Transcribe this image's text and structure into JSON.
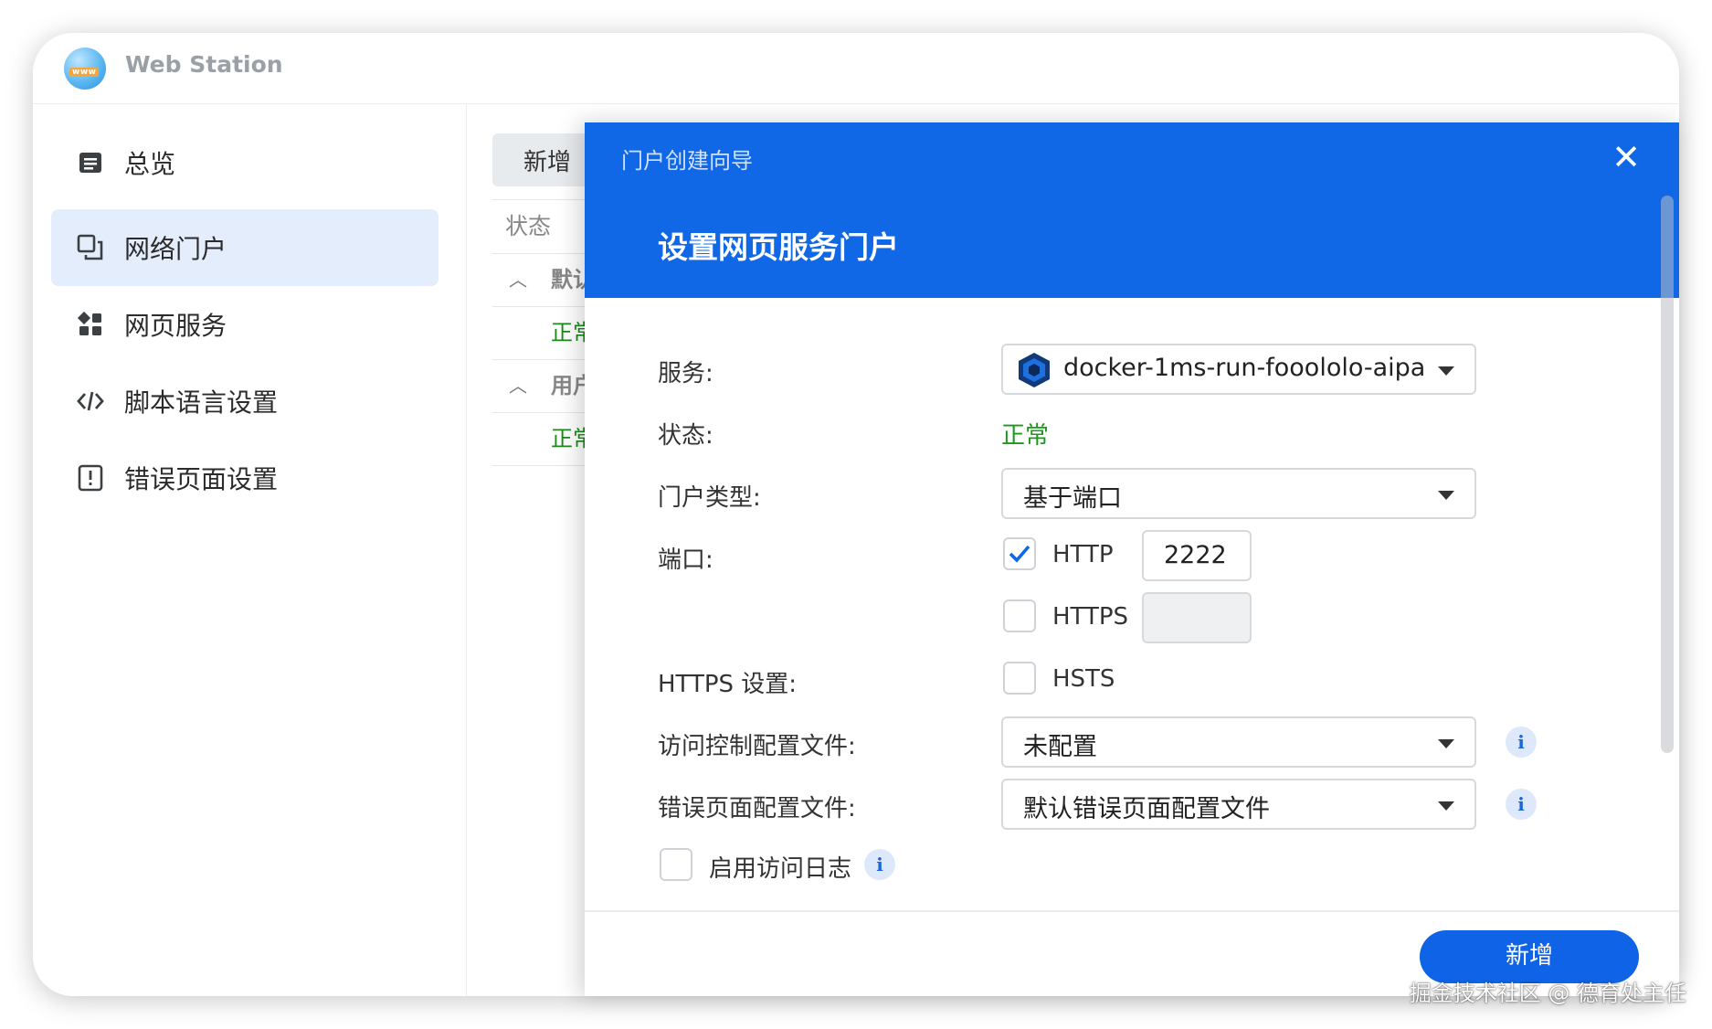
{
  "app": {
    "title": "Web Station",
    "logo_text": "www"
  },
  "sidebar": {
    "items": [
      {
        "label": "总览",
        "icon": "overview-icon",
        "active": false
      },
      {
        "label": "网络门户",
        "icon": "web-portal-icon",
        "active": true
      },
      {
        "label": "网页服务",
        "icon": "web-service-icon",
        "active": false
      },
      {
        "label": "脚本语言设置",
        "icon": "code-icon",
        "active": false
      },
      {
        "label": "错误页面设置",
        "icon": "error-page-icon",
        "active": false
      }
    ]
  },
  "main": {
    "add_button": "新增",
    "column_status": "状态",
    "groups": [
      {
        "label": "默认",
        "row_status": "正常"
      },
      {
        "label": "用户",
        "row_status": "正常"
      }
    ]
  },
  "wizard": {
    "title": "门户创建向导",
    "step_title": "设置网页服务门户",
    "fields": {
      "service_label": "服务:",
      "service_value": "docker-1ms-run-fooololo-aipa",
      "status_label": "状态:",
      "status_value": "正常",
      "portal_type_label": "门户类型:",
      "portal_type_value": "基于端口",
      "port_label": "端口:",
      "http_label": "HTTP",
      "http_checked": true,
      "http_port": "2222",
      "https_label": "HTTPS",
      "https_checked": false,
      "https_port": "",
      "https_settings_label": "HTTPS 设置:",
      "hsts_label": "HSTS",
      "hsts_checked": false,
      "access_profile_label": "访问控制配置文件:",
      "access_profile_value": "未配置",
      "error_profile_label": "错误页面配置文件:",
      "error_profile_value": "默认错误页面配置文件",
      "access_log_label": "启用访问日志",
      "access_log_checked": false
    },
    "submit_button": "新增"
  },
  "watermark": "掘金技术社区 @ 德育处主任",
  "colors": {
    "accent": "#1068e6",
    "status_ok": "#1a9a1a",
    "sidebar_active": "#e3edfb"
  }
}
